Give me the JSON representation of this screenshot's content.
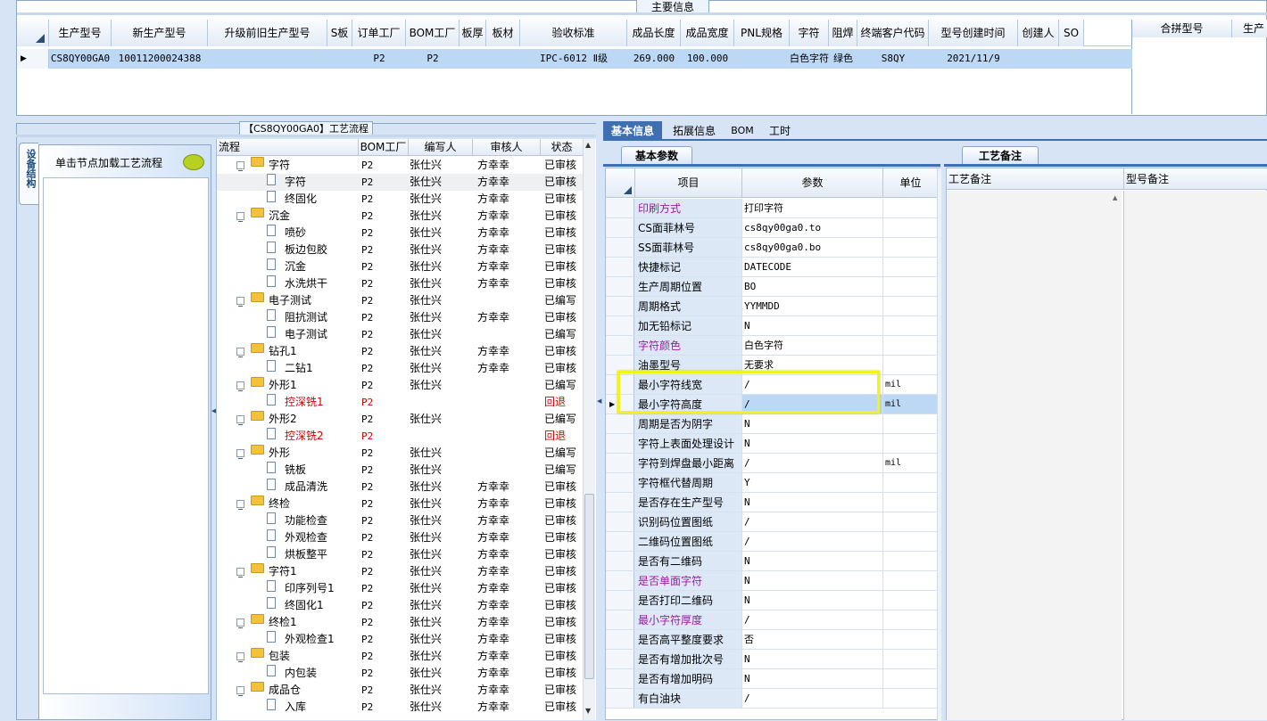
{
  "main_info": {
    "title": "主要信息",
    "columns": [
      "生产型号",
      "新生产型号",
      "升级前旧生产型号",
      "S板",
      "订单工厂",
      "BOM工厂",
      "板厚",
      "板材",
      "验收标准",
      "成品长度",
      "成品宽度",
      "PNL规格",
      "字符",
      "阻焊",
      "终端客户代码",
      "型号创建时间",
      "创建人",
      "SO"
    ],
    "row": [
      "CS8QY00GA0",
      "10011200024388",
      "",
      "",
      "P2",
      "P2",
      "",
      "",
      "IPC-6012 Ⅱ级",
      "269.000",
      "100.000",
      "",
      "白色字符",
      "绿色",
      "S8QY",
      "2021/11/9",
      "",
      ""
    ],
    "merge_columns": [
      "合拼型号",
      "生产"
    ]
  },
  "flow": {
    "title": "【CS8QY00GA0】工艺流程",
    "side_tab": "设备结构",
    "hint": "单击节点加载工艺流程",
    "columns": [
      "流程",
      "BOM工厂",
      "编写人",
      "审核人",
      "状态"
    ],
    "rows": [
      {
        "level": 1,
        "name": "字符",
        "bom": "P2",
        "writer": "张仕兴",
        "reviewer": "方幸幸",
        "status": "已审核",
        "red": false
      },
      {
        "level": 2,
        "name": "字符",
        "bom": "P2",
        "writer": "张仕兴",
        "reviewer": "方幸幸",
        "status": "已审核",
        "red": false
      },
      {
        "level": 2,
        "name": "终固化",
        "bom": "P2",
        "writer": "张仕兴",
        "reviewer": "方幸幸",
        "status": "已审核",
        "red": false
      },
      {
        "level": 1,
        "name": "沉金",
        "bom": "P2",
        "writer": "张仕兴",
        "reviewer": "方幸幸",
        "status": "已审核",
        "red": false
      },
      {
        "level": 2,
        "name": "喷砂",
        "bom": "P2",
        "writer": "张仕兴",
        "reviewer": "方幸幸",
        "status": "已审核",
        "red": false
      },
      {
        "level": 2,
        "name": "板边包胶",
        "bom": "P2",
        "writer": "张仕兴",
        "reviewer": "方幸幸",
        "status": "已审核",
        "red": false
      },
      {
        "level": 2,
        "name": "沉金",
        "bom": "P2",
        "writer": "张仕兴",
        "reviewer": "方幸幸",
        "status": "已审核",
        "red": false
      },
      {
        "level": 2,
        "name": "水洗烘干",
        "bom": "P2",
        "writer": "张仕兴",
        "reviewer": "方幸幸",
        "status": "已审核",
        "red": false
      },
      {
        "level": 1,
        "name": "电子测试",
        "bom": "P2",
        "writer": "张仕兴",
        "reviewer": "",
        "status": "已编写",
        "red": false
      },
      {
        "level": 2,
        "name": "阻抗测试",
        "bom": "P2",
        "writer": "张仕兴",
        "reviewer": "方幸幸",
        "status": "已审核",
        "red": false
      },
      {
        "level": 2,
        "name": "电子测试",
        "bom": "P2",
        "writer": "张仕兴",
        "reviewer": "",
        "status": "已编写",
        "red": false
      },
      {
        "level": 1,
        "name": "钻孔1",
        "bom": "P2",
        "writer": "张仕兴",
        "reviewer": "方幸幸",
        "status": "已审核",
        "red": false
      },
      {
        "level": 2,
        "name": "二钻1",
        "bom": "P2",
        "writer": "张仕兴",
        "reviewer": "方幸幸",
        "status": "已审核",
        "red": false
      },
      {
        "level": 1,
        "name": "外形1",
        "bom": "P2",
        "writer": "张仕兴",
        "reviewer": "",
        "status": "已编写",
        "red": false
      },
      {
        "level": 2,
        "name": "控深铣1",
        "bom": "P2",
        "writer": "",
        "reviewer": "",
        "status": "回退",
        "red": true
      },
      {
        "level": 1,
        "name": "外形2",
        "bom": "P2",
        "writer": "张仕兴",
        "reviewer": "",
        "status": "已编写",
        "red": false
      },
      {
        "level": 2,
        "name": "控深铣2",
        "bom": "P2",
        "writer": "",
        "reviewer": "",
        "status": "回退",
        "red": true
      },
      {
        "level": 1,
        "name": "外形",
        "bom": "P2",
        "writer": "张仕兴",
        "reviewer": "",
        "status": "已编写",
        "red": false
      },
      {
        "level": 2,
        "name": "铣板",
        "bom": "P2",
        "writer": "张仕兴",
        "reviewer": "",
        "status": "已编写",
        "red": false
      },
      {
        "level": 2,
        "name": "成品清洗",
        "bom": "P2",
        "writer": "张仕兴",
        "reviewer": "方幸幸",
        "status": "已审核",
        "red": false
      },
      {
        "level": 1,
        "name": "终检",
        "bom": "P2",
        "writer": "张仕兴",
        "reviewer": "方幸幸",
        "status": "已审核",
        "red": false
      },
      {
        "level": 2,
        "name": "功能检查",
        "bom": "P2",
        "writer": "张仕兴",
        "reviewer": "方幸幸",
        "status": "已审核",
        "red": false
      },
      {
        "level": 2,
        "name": "外观检查",
        "bom": "P2",
        "writer": "张仕兴",
        "reviewer": "方幸幸",
        "status": "已审核",
        "red": false
      },
      {
        "level": 2,
        "name": "烘板整平",
        "bom": "P2",
        "writer": "张仕兴",
        "reviewer": "方幸幸",
        "status": "已审核",
        "red": false
      },
      {
        "level": 1,
        "name": "字符1",
        "bom": "P2",
        "writer": "张仕兴",
        "reviewer": "方幸幸",
        "status": "已审核",
        "red": false
      },
      {
        "level": 2,
        "name": "印序列号1",
        "bom": "P2",
        "writer": "张仕兴",
        "reviewer": "方幸幸",
        "status": "已审核",
        "red": false
      },
      {
        "level": 2,
        "name": "终固化1",
        "bom": "P2",
        "writer": "张仕兴",
        "reviewer": "方幸幸",
        "status": "已审核",
        "red": false
      },
      {
        "level": 1,
        "name": "终检1",
        "bom": "P2",
        "writer": "张仕兴",
        "reviewer": "方幸幸",
        "status": "已审核",
        "red": false
      },
      {
        "level": 2,
        "name": "外观检查1",
        "bom": "P2",
        "writer": "张仕兴",
        "reviewer": "方幸幸",
        "status": "已审核",
        "red": false
      },
      {
        "level": 1,
        "name": "包装",
        "bom": "P2",
        "writer": "张仕兴",
        "reviewer": "方幸幸",
        "status": "已审核",
        "red": false
      },
      {
        "level": 2,
        "name": "内包装",
        "bom": "P2",
        "writer": "张仕兴",
        "reviewer": "方幸幸",
        "status": "已审核",
        "red": false
      },
      {
        "level": 1,
        "name": "成品仓",
        "bom": "P2",
        "writer": "张仕兴",
        "reviewer": "方幸幸",
        "status": "已审核",
        "red": false
      },
      {
        "level": 2,
        "name": "入库",
        "bom": "P2",
        "writer": "张仕兴",
        "reviewer": "方幸幸",
        "status": "已审核",
        "red": false
      }
    ]
  },
  "detail_tabs": [
    "基本信息",
    "拓展信息",
    "BOM",
    "工时"
  ],
  "basic_params": {
    "title": "基本参数",
    "columns": [
      "项目",
      "参数",
      "单位"
    ],
    "rows": [
      {
        "item": "印刷方式",
        "value": "打印字符",
        "unit": "",
        "purple": true
      },
      {
        "item": "CS面菲林号",
        "value": "cs8qy00ga0.to",
        "unit": "",
        "purple": false
      },
      {
        "item": "SS面菲林号",
        "value": "cs8qy00ga0.bo",
        "unit": "",
        "purple": false
      },
      {
        "item": "快捷标记",
        "value": "DATECODE",
        "unit": "",
        "purple": false
      },
      {
        "item": "生产周期位置",
        "value": "BO",
        "unit": "",
        "purple": false
      },
      {
        "item": "周期格式",
        "value": "YYMMDD",
        "unit": "",
        "purple": false
      },
      {
        "item": "加无铅标记",
        "value": "N",
        "unit": "",
        "purple": false
      },
      {
        "item": "字符颜色",
        "value": "白色字符",
        "unit": "",
        "purple": true
      },
      {
        "item": "油墨型号",
        "value": "无要求",
        "unit": "",
        "purple": false
      },
      {
        "item": "最小字符线宽",
        "value": "/",
        "unit": "mil",
        "purple": false
      },
      {
        "item": "最小字符高度",
        "value": "/",
        "unit": "mil",
        "purple": false
      },
      {
        "item": "周期是否为阴字",
        "value": "N",
        "unit": "",
        "purple": false
      },
      {
        "item": "字符上表面处理设计",
        "value": "N",
        "unit": "",
        "purple": false
      },
      {
        "item": "字符到焊盘最小距离",
        "value": "/",
        "unit": "mil",
        "purple": false
      },
      {
        "item": "字符框代替周期",
        "value": "Y",
        "unit": "",
        "purple": false
      },
      {
        "item": "是否存在生产型号",
        "value": "N",
        "unit": "",
        "purple": false
      },
      {
        "item": "识别码位置图纸",
        "value": "/",
        "unit": "",
        "purple": false
      },
      {
        "item": "二维码位置图纸",
        "value": "/",
        "unit": "",
        "purple": false
      },
      {
        "item": "是否有二维码",
        "value": "N",
        "unit": "",
        "purple": false
      },
      {
        "item": "是否单面字符",
        "value": "N",
        "unit": "",
        "purple": true
      },
      {
        "item": "是否打印二维码",
        "value": "N",
        "unit": "",
        "purple": false
      },
      {
        "item": "最小字符厚度",
        "value": "/",
        "unit": "",
        "purple": true
      },
      {
        "item": "是否高平整度要求",
        "value": "否",
        "unit": "",
        "purple": false
      },
      {
        "item": "是否有增加批次号",
        "value": "N",
        "unit": "",
        "purple": false
      },
      {
        "item": "是否有增加明码",
        "value": "N",
        "unit": "",
        "purple": false
      },
      {
        "item": "有白油块",
        "value": "/",
        "unit": "",
        "purple": false
      }
    ]
  },
  "process_notes": {
    "title": "工艺备注",
    "columns": [
      "工艺备注",
      "型号备注"
    ]
  },
  "colors": {
    "selected_row": "#bcd8f5",
    "purple": "#9b1d9e",
    "red": "#d40000",
    "highlight": "#f2f21c"
  }
}
